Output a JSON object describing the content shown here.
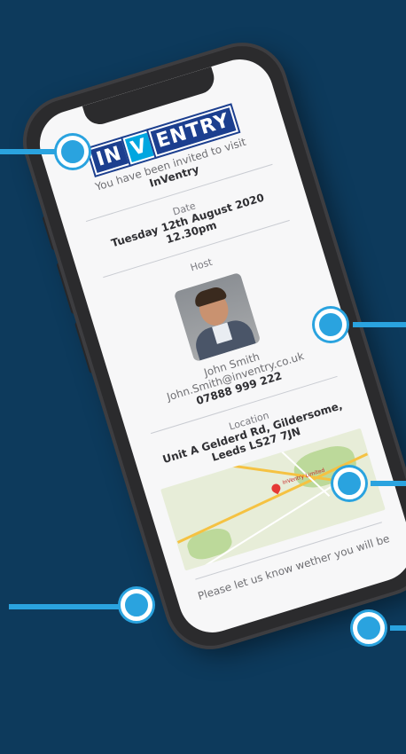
{
  "brand": {
    "logo_left": "IN",
    "logo_v": "V",
    "logo_right": "ENTRY",
    "colors": {
      "background": "#0d3a5c",
      "accent": "#2aa3df",
      "logo_blue": "#1c3f8f"
    }
  },
  "invite": {
    "line1": "You have been invited to visit",
    "place": "InVentry"
  },
  "date": {
    "label": "Date",
    "value": "Tuesday 12th August 2020",
    "time": "12.30pm"
  },
  "host": {
    "label": "Host",
    "name": "John Smith",
    "email": "John.Smith@inventry.co.uk",
    "phone": "07888 999 222"
  },
  "location": {
    "label": "Location",
    "address1": "Unit A Gelderd Rd, Gildersome,",
    "address2": "Leeds LS27 7JN"
  },
  "footer": {
    "text": "Please let us know wether you will be"
  },
  "map": {
    "marker_label": "InVentry Limited"
  }
}
